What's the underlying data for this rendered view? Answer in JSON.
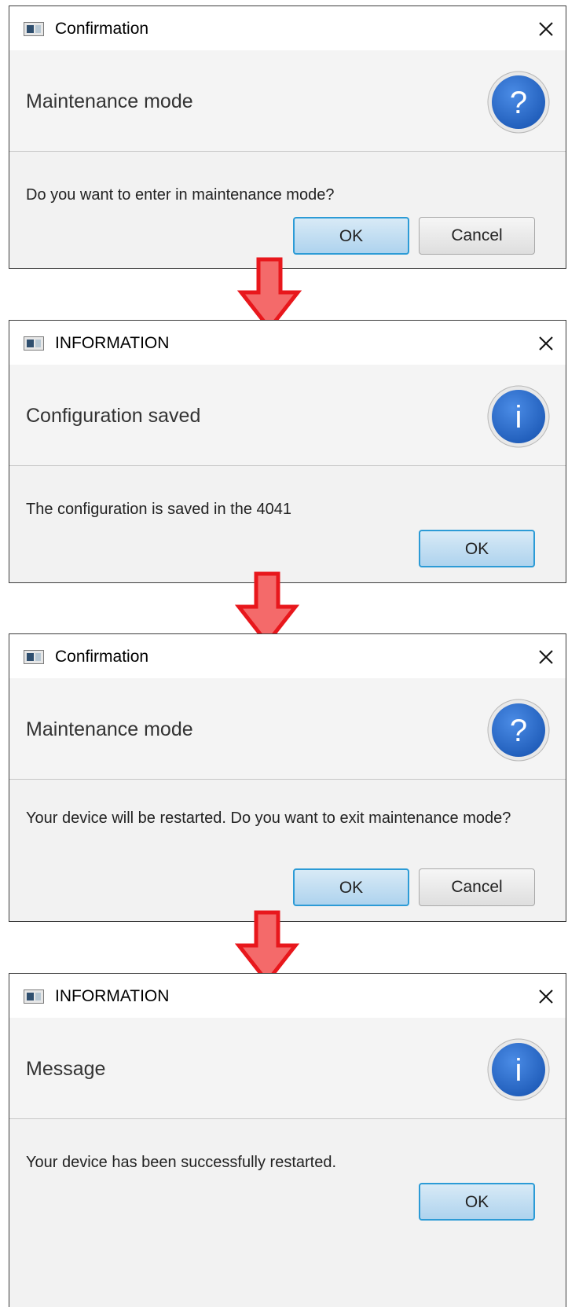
{
  "colors": {
    "accent_blue": "#2a6fd0",
    "default_button_border": "#2c9bd6",
    "arrow_fill": "#f46a6a",
    "arrow_stroke": "#e8171c"
  },
  "dialogs": [
    {
      "title": "Confirmation",
      "heading": "Maintenance mode",
      "icon": "question-icon",
      "icon_glyph": "?",
      "message": "Do you want to enter in maintenance mode?",
      "buttons": {
        "ok": "OK",
        "cancel": "Cancel"
      }
    },
    {
      "title": "INFORMATION",
      "heading": "Configuration saved",
      "icon": "info-icon",
      "icon_glyph": "i",
      "message": "The configuration is saved in the 4041",
      "buttons": {
        "ok": "OK"
      }
    },
    {
      "title": "Confirmation",
      "heading": "Maintenance mode",
      "icon": "question-icon",
      "icon_glyph": "?",
      "message": "Your device will be restarted. Do you want to exit maintenance mode?",
      "buttons": {
        "ok": "OK",
        "cancel": "Cancel"
      }
    },
    {
      "title": "INFORMATION",
      "heading": "Message",
      "icon": "info-icon",
      "icon_glyph": "i",
      "message": "Your device has been successfully restarted.",
      "buttons": {
        "ok": "OK"
      }
    }
  ]
}
